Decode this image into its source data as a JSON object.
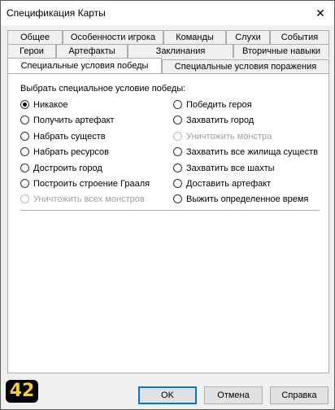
{
  "window": {
    "title": "Спецификация Карты",
    "close_glyph": "✕"
  },
  "tabs": {
    "row1": [
      "Общее",
      "Особенности игрока",
      "Команды",
      "Слухи",
      "События"
    ],
    "row2": [
      "Герои",
      "Артефакты",
      "Заклинания",
      "Вторичные навыки"
    ],
    "row3": [
      "Специальные условия победы",
      "Специальные условия поражения"
    ]
  },
  "active_tab": "Специальные условия победы",
  "panel": {
    "group_label": "Выбрать специальное условие победы:",
    "options": [
      {
        "label": "Никакое",
        "checked": true,
        "disabled": false
      },
      {
        "label": "Получить артефакт",
        "checked": false,
        "disabled": false
      },
      {
        "label": "Набрать существ",
        "checked": false,
        "disabled": false
      },
      {
        "label": "Набрать ресурсов",
        "checked": false,
        "disabled": false
      },
      {
        "label": "Достроить город",
        "checked": false,
        "disabled": false
      },
      {
        "label": "Построить строение Грааля",
        "checked": false,
        "disabled": false
      },
      {
        "label": "Уничтожить всех монстров",
        "checked": false,
        "disabled": true
      },
      {
        "label": "Победить героя",
        "checked": false,
        "disabled": false
      },
      {
        "label": "Захватить город",
        "checked": false,
        "disabled": false
      },
      {
        "label": "Уничтожить монстра",
        "checked": false,
        "disabled": true
      },
      {
        "label": "Захватить все жилища существ",
        "checked": false,
        "disabled": false
      },
      {
        "label": "Захватить все шахты",
        "checked": false,
        "disabled": false
      },
      {
        "label": "Доставить артефакт",
        "checked": false,
        "disabled": false
      },
      {
        "label": "Выжить определенное время",
        "checked": false,
        "disabled": false
      }
    ]
  },
  "badge": "42",
  "buttons": {
    "ok": "OK",
    "cancel": "Отмена",
    "help": "Справка"
  }
}
